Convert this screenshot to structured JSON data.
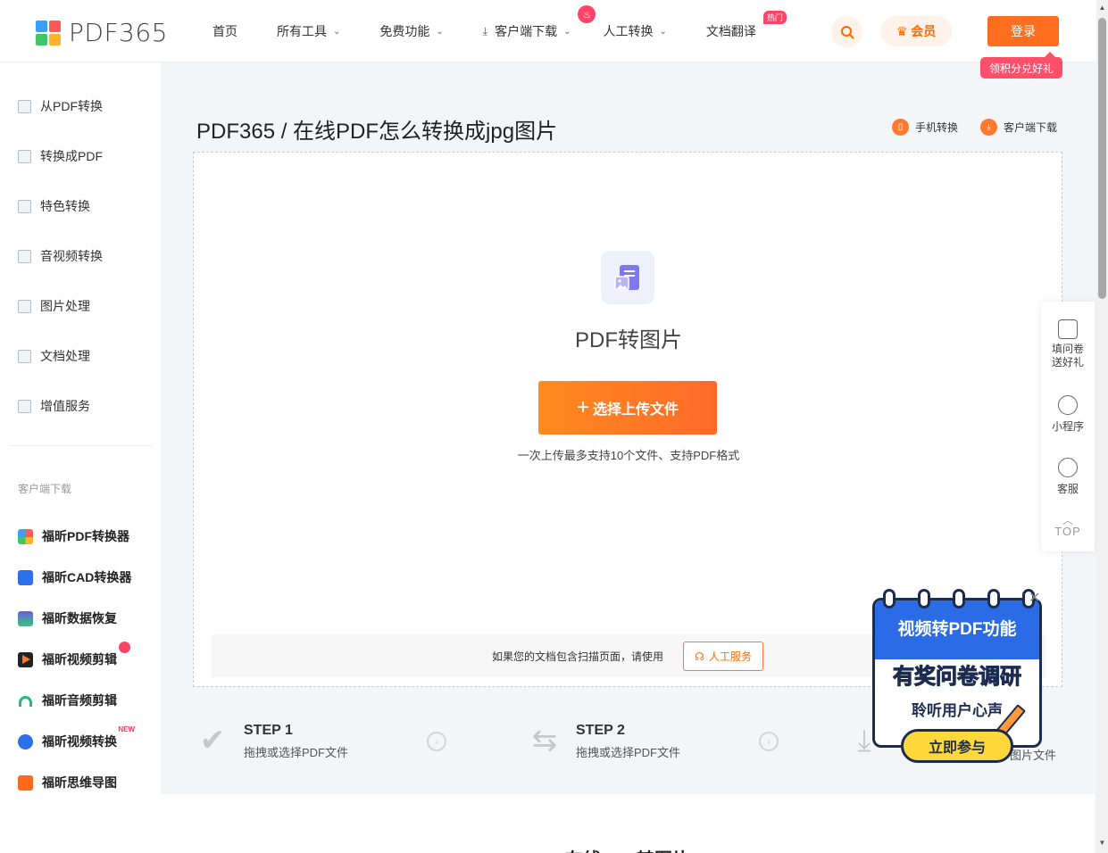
{
  "header": {
    "logo_text": "PDF365",
    "nav": [
      {
        "label": "首页"
      },
      {
        "label": "所有工具"
      },
      {
        "label": "免费功能"
      },
      {
        "label": "客户端下载"
      },
      {
        "label": "人工转换"
      },
      {
        "label": "文档翻译",
        "badge": "热门"
      }
    ],
    "vip_label": "会员",
    "login_label": "登录",
    "points_tag": "领积分兑好礼"
  },
  "sidebar": {
    "items": [
      {
        "label": "从PDF转换"
      },
      {
        "label": "转换成PDF"
      },
      {
        "label": "特色转换"
      },
      {
        "label": "音视频转换"
      },
      {
        "label": "图片处理"
      },
      {
        "label": "文档处理"
      },
      {
        "label": "增值服务"
      }
    ],
    "caption": "客户端下载",
    "apps": [
      {
        "label": "福昕PDF转换器"
      },
      {
        "label": "福昕CAD转换器"
      },
      {
        "label": "福昕数据恢复"
      },
      {
        "label": "福昕视频剪辑"
      },
      {
        "label": "福昕音频剪辑"
      },
      {
        "label": "福昕视频转换",
        "badge": "NEW"
      },
      {
        "label": "福昕思维导图"
      }
    ]
  },
  "main": {
    "page_title": "PDF365 / 在线PDF怎么转换成jpg图片",
    "mobile_label": "手机转换",
    "client_label": "客户端下载",
    "tool_name": "PDF转图片",
    "upload_button": "选择上传文件",
    "upload_hint": "一次上传最多支持10个文件、支持PDF格式",
    "scan_text": "如果您的文档包含扫描页面，请使用",
    "scan_button": "人工服务",
    "steps": [
      {
        "title": "STEP 1",
        "desc": "拖拽或选择PDF文件"
      },
      {
        "title": "STEP 2",
        "desc": "拖拽或选择PDF文件"
      },
      {
        "title": "",
        "desc": "图片文件"
      }
    ],
    "below_title": "在线PDF转图片"
  },
  "float_panel": {
    "survey": "填问卷\n送好礼",
    "mini_program": "小程序",
    "service": "客服",
    "top": "TOP"
  },
  "ad": {
    "title": "视频转PDF功能",
    "big": "有奖问卷调研",
    "sub": "聆听用户心声",
    "button": "立即参与"
  },
  "colors": {
    "accent": "#ff6d1f",
    "points_tag": "#ff4f6b",
    "ad_blue": "#2b6ce6",
    "ad_yellow": "#ffd93b"
  }
}
